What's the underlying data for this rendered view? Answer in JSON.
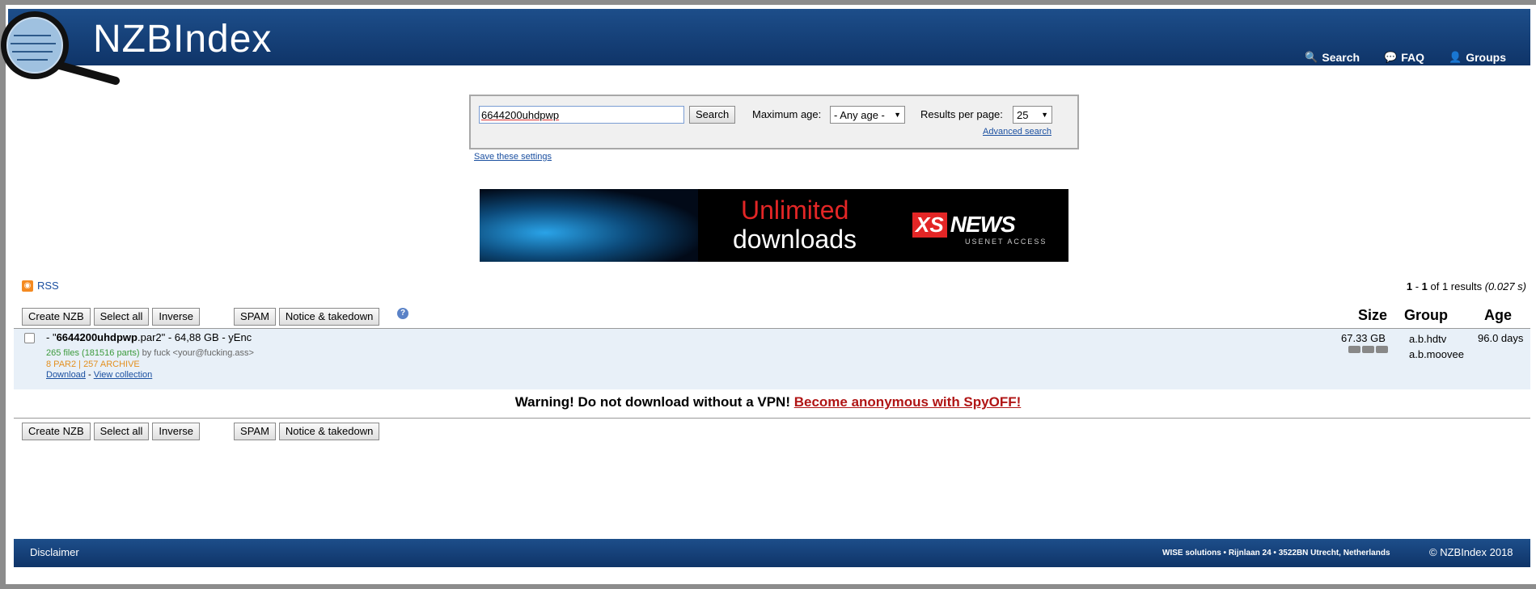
{
  "header": {
    "logo": "NZBIndex",
    "nav": [
      {
        "label": "Search",
        "icon": "search-icon"
      },
      {
        "label": "FAQ",
        "icon": "faq-icon"
      },
      {
        "label": "Groups",
        "icon": "groups-icon"
      }
    ]
  },
  "search": {
    "query": "6644200uhdpwp",
    "button": "Search",
    "max_age_label": "Maximum age:",
    "max_age_value": "- Any age -",
    "results_per_page_label": "Results per page:",
    "results_per_page_value": "25",
    "advanced_link": "Advanced search",
    "save_settings": "Save these settings"
  },
  "banner": {
    "line1": "Unlimited",
    "line2": "downloads",
    "brand_box": "XS",
    "brand_word": "NEWS",
    "brand_sub": "USENET ACCESS"
  },
  "rss_label": "RSS",
  "results_info": {
    "from": "1",
    "dash": " - ",
    "to": "1",
    "of_text": " of 1 results ",
    "time": "(0.027 s)"
  },
  "toolbar": {
    "create_nzb": "Create NZB",
    "select_all": "Select all",
    "inverse": "Inverse",
    "spam": "SPAM",
    "notice": "Notice & takedown"
  },
  "columns": {
    "size": "Size",
    "group": "Group",
    "age": "Age"
  },
  "result": {
    "prefix": "- \"",
    "title_bold": "6644200uhdpwp",
    "title_rest": ".par2\" - 64,88 GB - yEnc",
    "files": "265 files (181516 parts)",
    "by": " by fuck <your@fucking.ass>",
    "par": "8 PAR2 | 257 ARCHIVE",
    "download": "Download",
    "sep": " - ",
    "view_collection": "View collection",
    "size": "67.33 GB",
    "group1": "a.b.hdtv",
    "group2": "a.b.moovee",
    "age": "96.0 days"
  },
  "warning": {
    "text": "Warning! Do not download without a VPN! ",
    "link": "Become anonymous with SpyOFF!"
  },
  "footer": {
    "disclaimer": "Disclaimer",
    "address": "WISE solutions • Rijnlaan 24 • 3522BN Utrecht, Netherlands",
    "copyright": "© NZBIndex 2018"
  }
}
